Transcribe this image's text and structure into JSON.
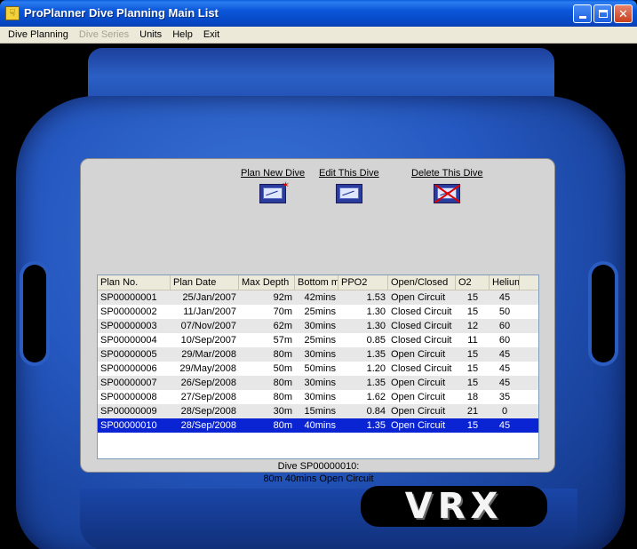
{
  "window": {
    "title": "ProPlanner Dive Planning Main List"
  },
  "menu": {
    "items": [
      {
        "label": "Dive Planning",
        "enabled": true
      },
      {
        "label": "Dive Series",
        "enabled": false
      },
      {
        "label": "Units",
        "enabled": true
      },
      {
        "label": "Help",
        "enabled": true
      },
      {
        "label": "Exit",
        "enabled": true
      }
    ]
  },
  "actions": {
    "plan_new": "Plan New Dive",
    "edit": "Edit This Dive",
    "delete": "Delete This Dive"
  },
  "table": {
    "columns": [
      "Plan No.",
      "Plan Date",
      "Max Depth",
      "Bottom m",
      "PPO2",
      "Open/Closed",
      "O2",
      "Helium"
    ],
    "rows": [
      [
        "SP00000001",
        "25/Jan/2007",
        "92m",
        "42mins",
        "1.53",
        "Open Circuit",
        "15",
        "45"
      ],
      [
        "SP00000002",
        "11/Jan/2007",
        "70m",
        "25mins",
        "1.30",
        "Closed Circuit",
        "15",
        "50"
      ],
      [
        "SP00000003",
        "07/Nov/2007",
        "62m",
        "30mins",
        "1.30",
        "Closed Circuit",
        "12",
        "60"
      ],
      [
        "SP00000004",
        "10/Sep/2007",
        "57m",
        "25mins",
        "0.85",
        "Closed Circuit",
        "11",
        "60"
      ],
      [
        "SP00000005",
        "29/Mar/2008",
        "80m",
        "30mins",
        "1.35",
        "Open Circuit",
        "15",
        "45"
      ],
      [
        "SP00000006",
        "29/May/2008",
        "50m",
        "50mins",
        "1.20",
        "Closed Circuit",
        "15",
        "45"
      ],
      [
        "SP00000007",
        "26/Sep/2008",
        "80m",
        "30mins",
        "1.35",
        "Open Circuit",
        "15",
        "45"
      ],
      [
        "SP00000008",
        "27/Sep/2008",
        "80m",
        "30mins",
        "1.62",
        "Open Circuit",
        "18",
        "35"
      ],
      [
        "SP00000009",
        "28/Sep/2008",
        "30m",
        "15mins",
        "0.84",
        "Open Circuit",
        "21",
        "0"
      ],
      [
        "SP00000010",
        "28/Sep/2008",
        "80m",
        "40mins",
        "1.35",
        "Open Circuit",
        "15",
        "45"
      ]
    ],
    "selected_index": 9
  },
  "status": {
    "line1": "Dive SP00000010:",
    "line2": "80m 40mins Open Circuit"
  },
  "logo": {
    "text": "VRX"
  },
  "colors": {
    "titlebar": "#0a56d8",
    "selection": "#0a24d4",
    "device_blue": "#2558c0",
    "screen_gray": "#d4d4d4"
  }
}
